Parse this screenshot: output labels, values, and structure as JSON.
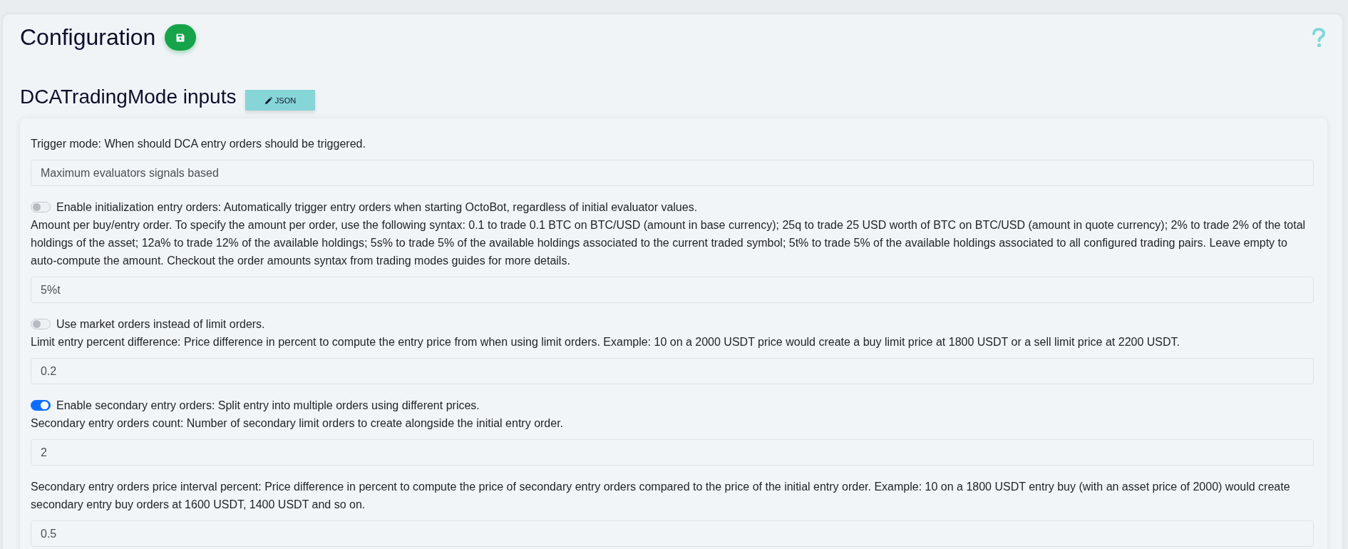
{
  "page": {
    "title": "Configuration"
  },
  "section": {
    "title": "DCATradingMode inputs",
    "json_button": "JSON"
  },
  "settings": [
    {
      "kind": "select",
      "label": "Trigger mode: When should DCA entry orders should be triggered.",
      "value": "Maximum evaluators signals based"
    },
    {
      "kind": "toggle",
      "label": "Enable initialization entry orders: Automatically trigger entry orders when starting OctoBot, regardless of initial evaluator values.",
      "on": false
    },
    {
      "kind": "input",
      "label": "Amount per buy/entry order. To specify the amount per order, use the following syntax: 0.1 to trade 0.1 BTC on BTC/USD (amount in base currency); 25q to trade 25 USD worth of BTC on BTC/USD (amount in quote currency); 2% to trade 2% of the total holdings of the asset; 12a% to trade 12% of the available holdings; 5s% to trade 5% of the available holdings associated to the current traded symbol; 5t% to trade 5% of the available holdings associated to all configured trading pairs. Leave empty to auto-compute the amount. Checkout the order amounts syntax from trading modes guides for more details.",
      "value": "5%t"
    },
    {
      "kind": "toggle",
      "label": "Use market orders instead of limit orders.",
      "on": false
    },
    {
      "kind": "input",
      "label": "Limit entry percent difference: Price difference in percent to compute the entry price from when using limit orders. Example: 10 on a 2000 USDT price would create a buy limit price at 1800 USDT or a sell limit price at 2200 USDT.",
      "value": "0.2"
    },
    {
      "kind": "toggle",
      "label": "Enable secondary entry orders: Split entry into multiple orders using different prices.",
      "on": true
    },
    {
      "kind": "input",
      "label": "Secondary entry orders count: Number of secondary limit orders to create alongside the initial entry order.",
      "value": "2"
    },
    {
      "kind": "input",
      "label": "Secondary entry orders price interval percent: Price difference in percent to compute the price of secondary entry orders compared to the price of the initial entry order. Example: 10 on a 1800 USDT entry buy (with an asset price of 2000) would create secondary entry buy orders at 1600 USDT, 1400 USDT and so on.",
      "value": "0.5"
    }
  ]
}
